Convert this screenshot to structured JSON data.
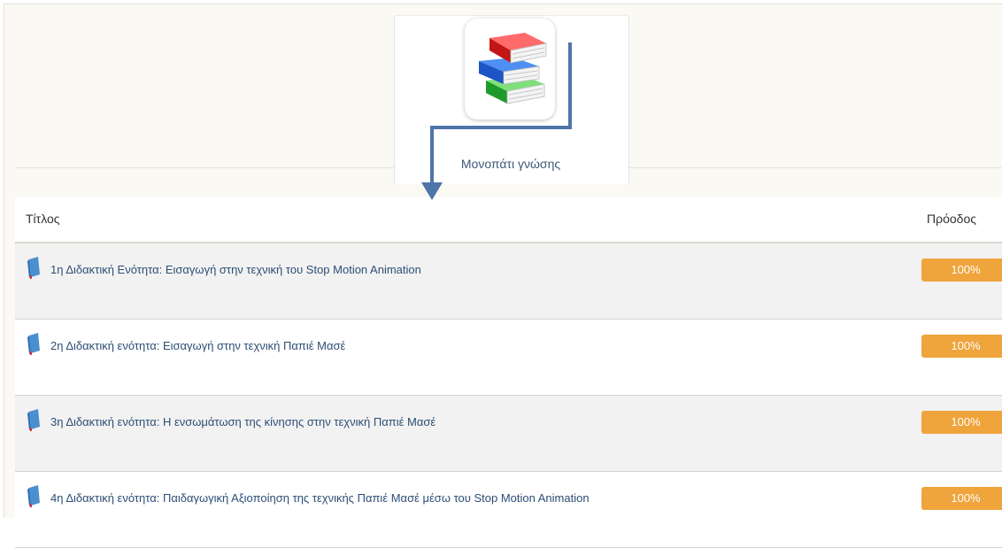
{
  "tab": {
    "label": "Μονοπάτι γνώσης",
    "icon": "books-stack-icon"
  },
  "table": {
    "headers": {
      "title": "Τίτλος",
      "progress": "Πρόοδος"
    },
    "rows": [
      {
        "title": "1η Διδακτική Ενότητα: Εισαγωγή στην τεχνική του Stop Motion Animation",
        "progress": "100%"
      },
      {
        "title": "2η Διδακτική ενότητα: Εισαγωγή στην τεχνική Παπιέ Μασέ",
        "progress": "100%"
      },
      {
        "title": "3η Διδακτική ενότητα: Η ενσωμάτωση της κίνησης στην τεχνική Παπιέ Μασέ",
        "progress": "100%"
      },
      {
        "title": "4η Διδακτική ενότητα: Παιδαγωγική Αξιοποίηση της τεχνικής Παπιέ Μασέ μέσω του Stop Motion Animation",
        "progress": "100%"
      }
    ]
  },
  "colors": {
    "progress_badge": "#efa43c",
    "link": "#2c4e76",
    "annotation_arrow": "#4f74a8",
    "row_icon": "#4a8fd0"
  },
  "icons": {
    "row_icon": "book-icon",
    "annotation": "down-arrow-annotation"
  }
}
